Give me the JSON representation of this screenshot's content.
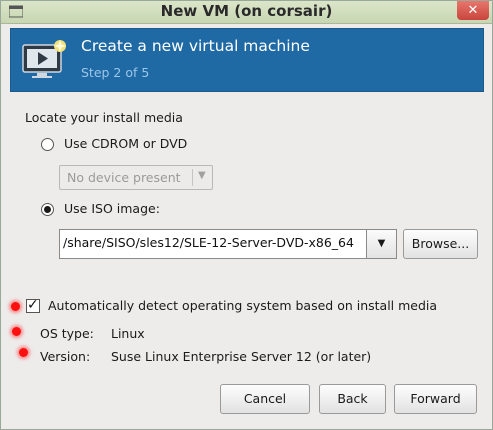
{
  "window": {
    "title": "New VM (on corsair)",
    "close_glyph": "✕"
  },
  "header": {
    "title": "Create a new virtual machine",
    "step": "Step 2 of 5",
    "icon": "monitor-new-vm-icon",
    "background_color": "#1f6aa5"
  },
  "media": {
    "section_label": "Locate your install media",
    "cdrom_label": "Use CDROM or DVD",
    "cdrom_selected": false,
    "device_combo_value": "No device present",
    "iso_label": "Use ISO image:",
    "iso_selected": true,
    "iso_path": "/share/SISO/sles12/SLE-12-Server-DVD-x86_64",
    "browse_label": "Browse..."
  },
  "os": {
    "auto_detect_label": "Automatically detect operating system based on install media",
    "auto_detect_checked": true,
    "os_type_label": "OS type:",
    "os_type_value": "Linux",
    "version_label": "Version:",
    "version_value": "Suse Linux Enterprise Server 12 (or later)"
  },
  "buttons": {
    "cancel": "Cancel",
    "back": "Back",
    "forward": "Forward"
  },
  "annotation_color": "#ff1010"
}
